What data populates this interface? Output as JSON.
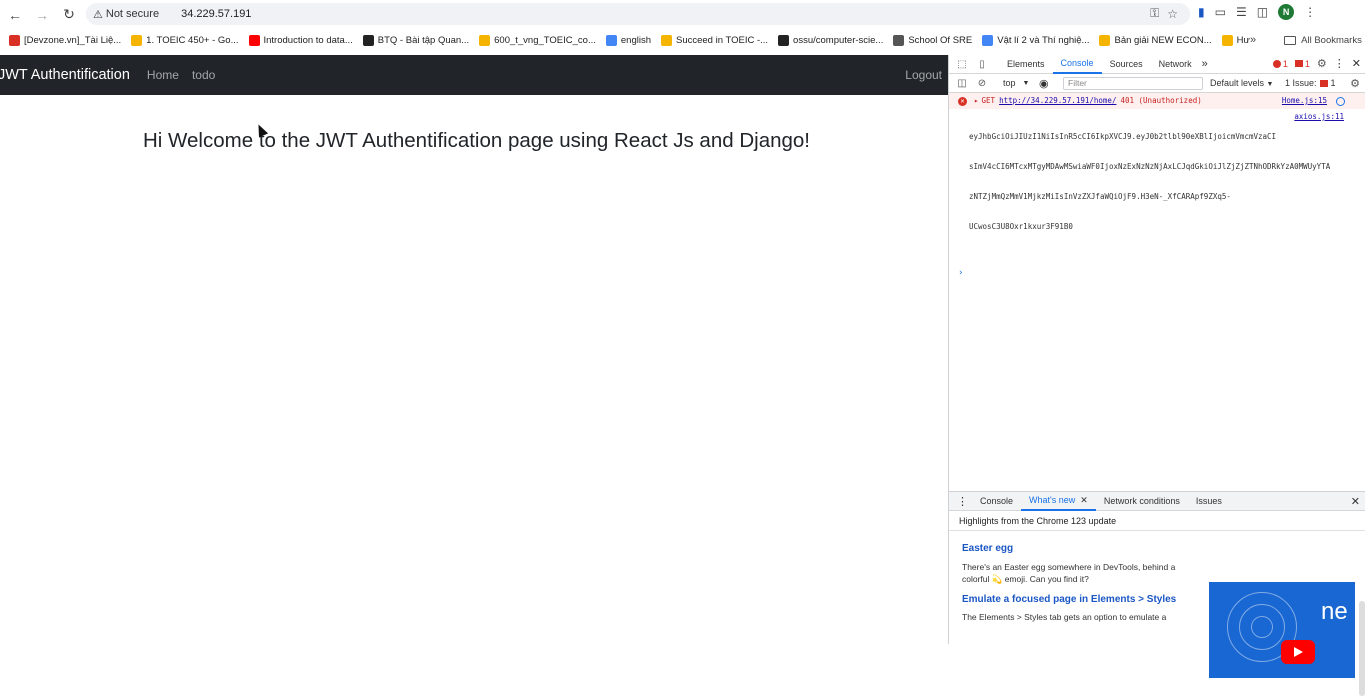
{
  "browser": {
    "security_label": "Not secure",
    "url": "34.229.57.191",
    "profile_initial": "N"
  },
  "bookmarks": [
    {
      "label": "[Devzone.vn]_Tài Liệ...",
      "color": "#d93025"
    },
    {
      "label": "1. TOEIC 450+ - Go...",
      "color": "#f4b400"
    },
    {
      "label": "Introduction to data...",
      "color": "#ff0000"
    },
    {
      "label": "BTQ - Bài tập Quan...",
      "color": "#222222"
    },
    {
      "label": "600_t_vng_TOEIC_co...",
      "color": "#f4b400"
    },
    {
      "label": "english",
      "color": "#4285f4"
    },
    {
      "label": "Succeed in TOEIC -...",
      "color": "#f4b400"
    },
    {
      "label": "ossu/computer-scie...",
      "color": "#222222"
    },
    {
      "label": "School Of SRE",
      "color": "#555555"
    },
    {
      "label": "Vật lí 2 và Thí nghiệ...",
      "color": "#4285f4"
    },
    {
      "label": "Bản giải NEW ECON...",
      "color": "#f4b400"
    },
    {
      "label": "Hướng dẫn chi tiết...",
      "color": "#f4b400"
    }
  ],
  "bookmarks_all": "All Bookmarks",
  "app": {
    "brand": "JWT Authentification",
    "nav": [
      "Home",
      "todo"
    ],
    "logout": "Logout",
    "heading": "Hi Welcome to the JWT Authentification page using React Js and Django!"
  },
  "devtools": {
    "tabs": [
      "Elements",
      "Console",
      "Sources",
      "Network"
    ],
    "active_tab": "Console",
    "error_count": "1",
    "issue_count": "1",
    "context": "top",
    "filter_placeholder": "Filter",
    "levels": "Default levels",
    "issues_label": "1 Issue:",
    "issues_num": "1",
    "error": {
      "method": "GET",
      "url": "http://34.229.57.191/home/",
      "status": "401 (Unauthorized)",
      "source": "Home.js:15"
    },
    "token_lines": [
      "eyJhbGciOiJIUzI1NiIsInR5cCI6IkpXVCJ9.eyJ0b2tlbl90eXBlIjoicmVmcmVzaCI",
      "sImV4cCI6MTcxMTgyMDAwMSwiaWF0IjoxNzExNzNzNjAxLCJqdGkiOiJlZjZjZTNhODRkYzA0MWUyYTA",
      "zNTZjMmQzMmV1MjkzMiIsInVzZXJfaWQiOjF9.H3eN-_XfCARApf9ZXq5-",
      "UCwosC3U8Oxr1kxur3F91B0"
    ],
    "token_source": "axios.js:11",
    "drawer_tabs": [
      "Console",
      "What's new",
      "Network conditions",
      "Issues"
    ],
    "drawer_active": "What's new",
    "whats_new_header": "Highlights from the Chrome 123 update",
    "items": [
      {
        "title": "Easter egg",
        "text": "There's an Easter egg somewhere in DevTools, behind a colorful 💫 emoji. Can you find it?"
      },
      {
        "title": "Emulate a focused page in Elements > Styles",
        "text": "The Elements > Styles tab gets an option to emulate a"
      }
    ],
    "promo_text": "ne"
  }
}
